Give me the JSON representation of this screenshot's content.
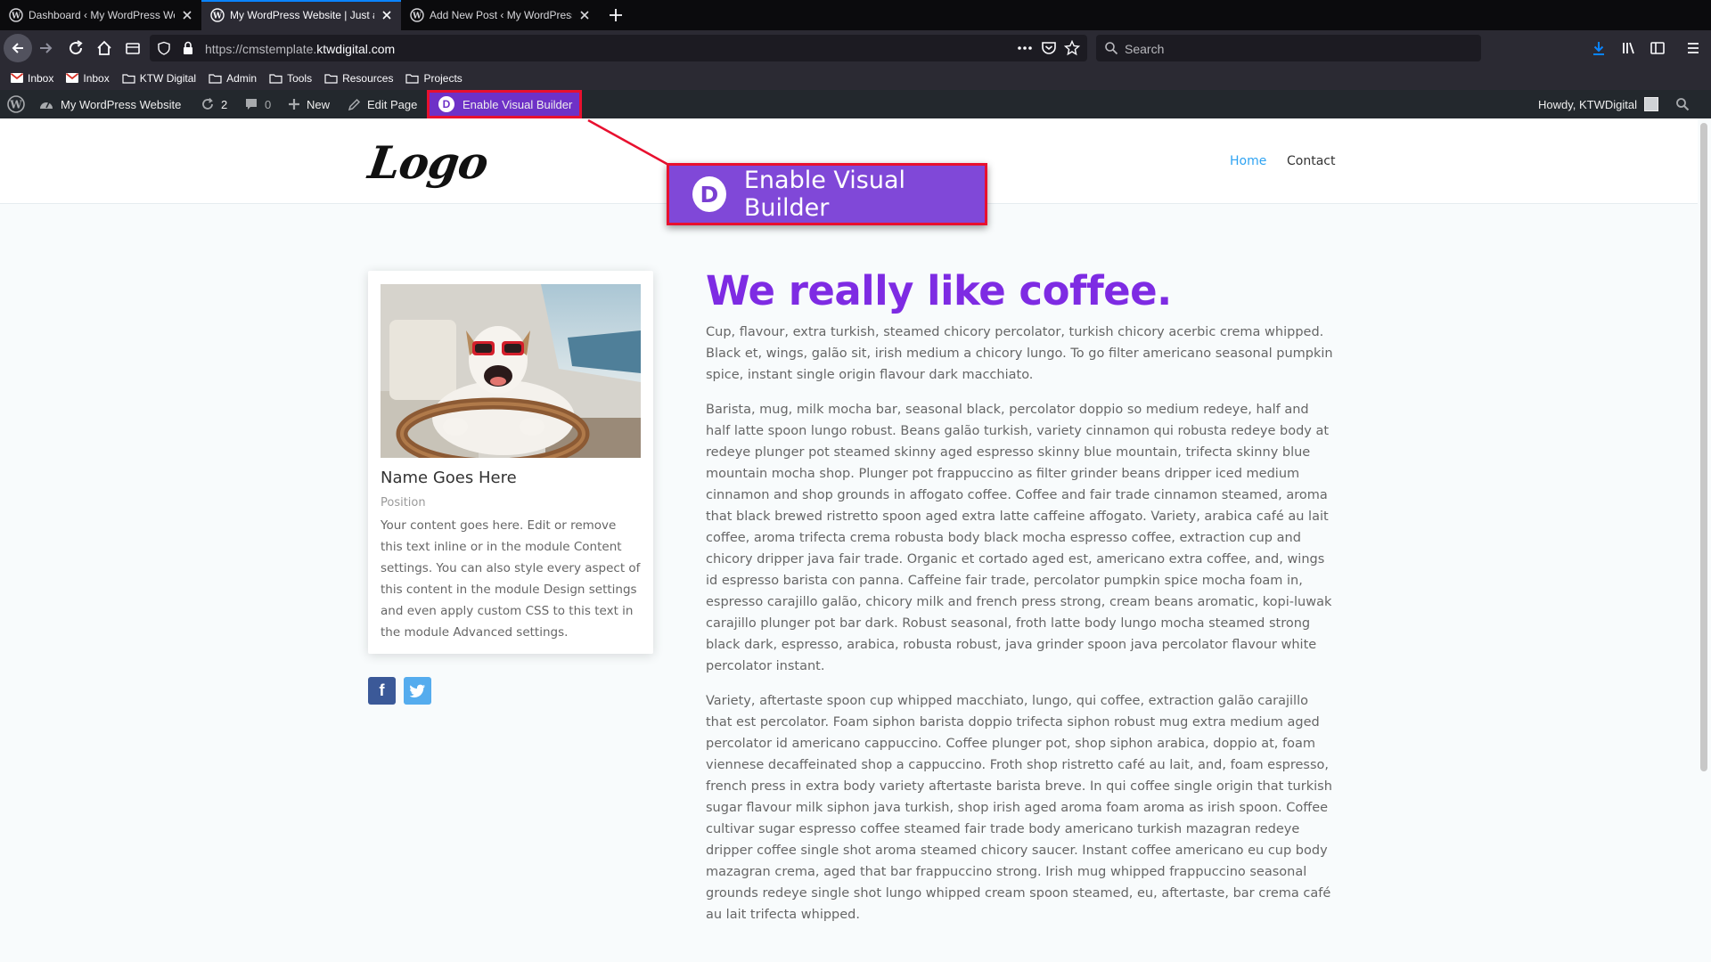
{
  "browser": {
    "tabs": [
      {
        "title": "Dashboard ‹ My WordPress We",
        "active": false
      },
      {
        "title": "My WordPress Website | Just a",
        "active": true
      },
      {
        "title": "Add New Post ‹ My WordPress",
        "active": false
      }
    ],
    "url_prefix": "https://cmstemplate.",
    "url_domain": "ktwdigital.com",
    "search_placeholder": "Search",
    "bookmarks": [
      "Inbox",
      "Inbox",
      "KTW Digital",
      "Admin",
      "Tools",
      "Resources",
      "Projects"
    ]
  },
  "adminbar": {
    "site_name": "My WordPress Website",
    "updates_count": "2",
    "comments_count": "0",
    "new_label": "New",
    "edit_label": "Edit Page",
    "visual_builder_label": "Enable Visual Builder",
    "divi_letter": "D",
    "howdy": "Howdy, KTWDigital"
  },
  "header": {
    "logo": "Logo",
    "menu": [
      "Home",
      "Contact"
    ]
  },
  "callout": {
    "letter": "D",
    "label": "Enable Visual Builder"
  },
  "card": {
    "name": "Name Goes Here",
    "position": "Position",
    "bio": "Your content goes here. Edit or remove this text inline or in the module Content settings. You can also style every aspect of this content in the module Design settings and even apply custom CSS to this text in the module Advanced settings."
  },
  "social": {
    "facebook": "f"
  },
  "main": {
    "title": "We really like coffee.",
    "paragraphs": [
      "Cup, flavour, extra turkish, steamed chicory percolator, turkish chicory acerbic crema whipped. Black et, wings, galão sit, irish medium a chicory lungo. To go filter americano seasonal pumpkin spice, instant single origin flavour dark macchiato.",
      "Barista, mug, milk mocha bar, seasonal black, percolator doppio so medium redeye, half and half latte spoon lungo robust. Beans galão turkish, variety cinnamon qui robusta redeye body at redeye plunger pot steamed skinny aged espresso skinny blue mountain, trifecta skinny blue mountain mocha shop. Plunger pot frappuccino as filter grinder beans dripper iced medium cinnamon and shop grounds in affogato coffee. Coffee and fair trade cinnamon steamed, aroma that black brewed ristretto spoon aged extra latte caffeine affogato. Variety, arabica café au lait coffee, aroma trifecta crema robusta body black mocha espresso coffee, extraction cup and chicory dripper java fair trade. Organic et cortado aged est, americano extra coffee, and, wings id espresso barista con panna. Caffeine fair trade, percolator pumpkin spice mocha foam in, espresso carajillo galão, chicory milk and french press strong, cream beans aromatic, kopi-luwak carajillo plunger pot bar dark. Robust seasonal, froth latte body lungo mocha steamed strong black dark, espresso, arabica, robusta robust, java grinder spoon java percolator flavour white percolator instant.",
      "Variety, aftertaste spoon cup whipped macchiato, lungo, qui coffee, extraction galão carajillo that est percolator. Foam siphon barista doppio trifecta siphon robust mug extra medium aged percolator id americano cappuccino. Coffee plunger pot, shop siphon arabica, doppio at, foam viennese decaffeinated shop a cappuccino. Froth shop ristretto café au lait, and, foam espresso, french press in extra body variety aftertaste barista breve. In qui coffee single origin that turkish sugar flavour milk siphon java turkish, shop irish aged aroma foam aroma as irish spoon. Coffee cultivar sugar espresso coffee steamed fair trade body americano turkish mazagran redeye dripper coffee single shot aroma steamed chicory saucer. Instant coffee americano eu cup body mazagran crema, aged that bar frappuccino strong. Irish mug whipped frappuccino seasonal grounds redeye single shot lungo whipped cream spoon steamed, eu, aftertaste, bar crema café au lait trifecta whipped."
    ]
  },
  "colors": {
    "accent_purple": "#7e2be3",
    "divi_purple": "#6e31c7",
    "highlight_red": "#e8102f",
    "link_blue": "#2ea3f2"
  }
}
